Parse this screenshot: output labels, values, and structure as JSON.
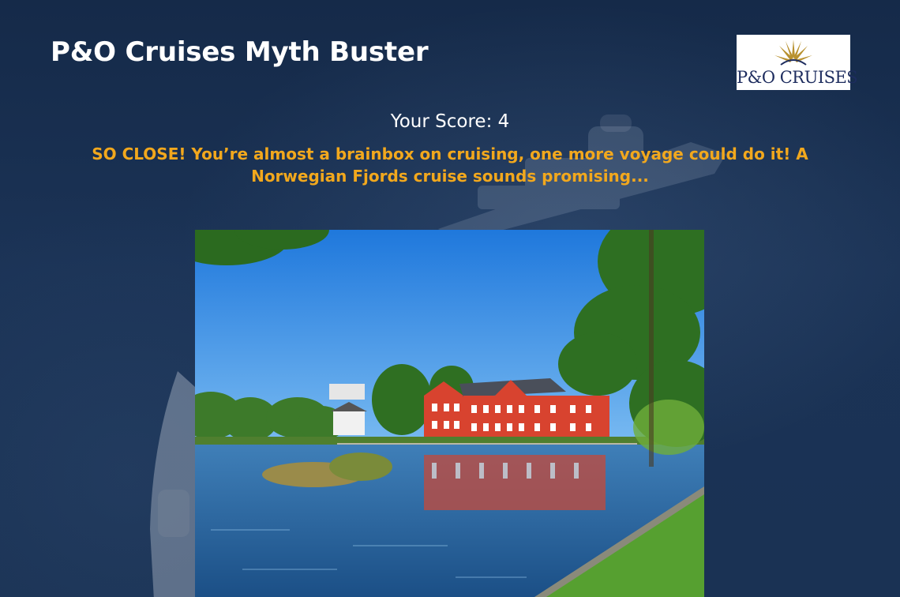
{
  "page": {
    "title": "P&O Cruises Myth Buster",
    "logo_text": "P&O CRUISES",
    "score_text": "Your Score: 4",
    "result_message": "SO CLOSE! You’re almost a brainbox on cruising, one more voyage could do it! A Norwegian Fjords cruise sounds promising..."
  },
  "colors": {
    "background": "#142848",
    "title": "#ffffff",
    "message": "#f2a81d",
    "logo_navy": "#1d2c5e",
    "logo_gold": "#b8912f"
  },
  "icons": {
    "logo_emblem": "sun-star-icon"
  }
}
